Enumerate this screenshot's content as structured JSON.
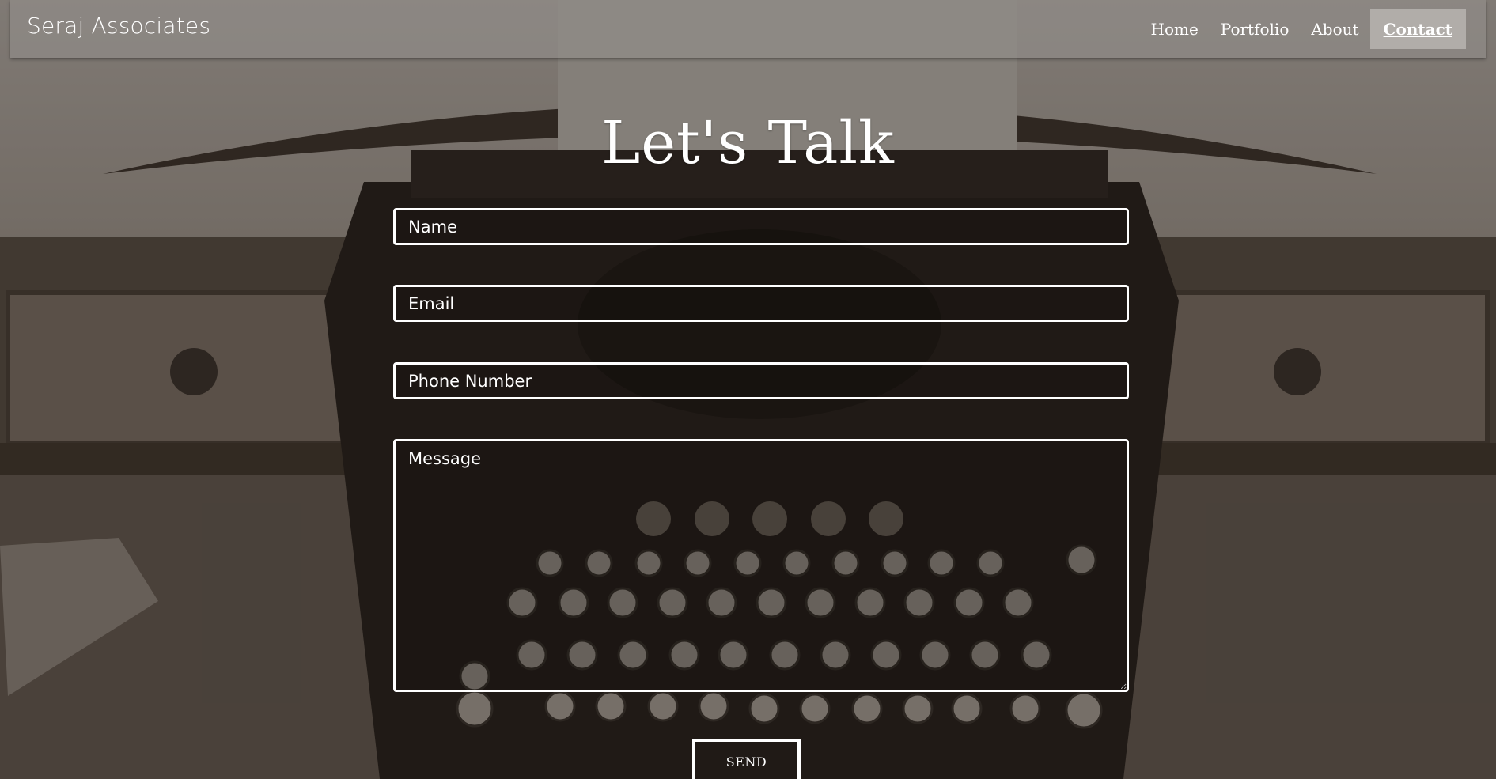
{
  "navbar": {
    "brand": "Seraj Associates",
    "links": [
      {
        "label": "Home",
        "active": false
      },
      {
        "label": "Portfolio",
        "active": false
      },
      {
        "label": "About",
        "active": false
      },
      {
        "label": "Contact",
        "active": true
      }
    ]
  },
  "contact": {
    "heading": "Let's Talk",
    "fields": {
      "name": {
        "placeholder": "Name",
        "value": ""
      },
      "email": {
        "placeholder": "Email",
        "value": ""
      },
      "phone": {
        "placeholder": "Phone Number",
        "value": ""
      },
      "message": {
        "placeholder": "Message",
        "value": ""
      }
    },
    "send_label": "SEND"
  },
  "colors": {
    "text": "#ffffff",
    "navbar_bg": "rgba(150,146,142,0.55)",
    "active_link_bg": "rgba(210,206,202,0.55)",
    "field_border": "#ffffff"
  },
  "background": {
    "subject": "vintage-typewriter-on-wooden-desk",
    "tone": "sepia"
  }
}
